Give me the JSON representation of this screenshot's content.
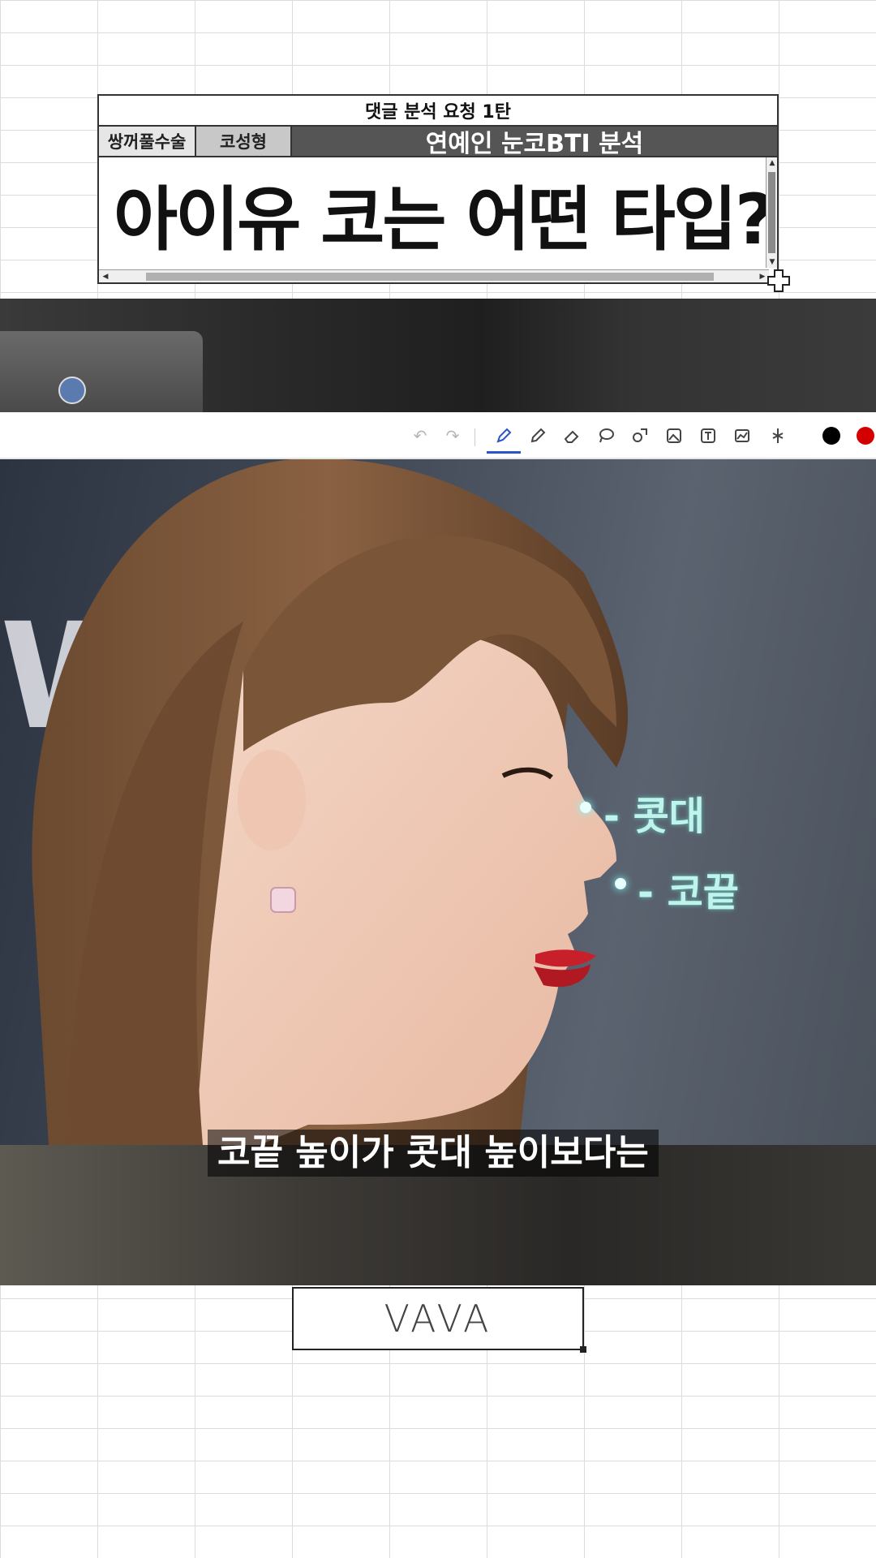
{
  "header": {
    "top_title": "댓글 분석 요청 1탄",
    "tag_1": "쌍꺼풀수술",
    "tag_2": "코성형",
    "tag_3": "연예인 눈코BTI 분석",
    "main_title": "아이유 코는 어떤 타입?"
  },
  "toolbar": {
    "tools": [
      "undo-icon",
      "redo-icon",
      "pen-icon",
      "pencil-icon",
      "eraser-icon",
      "lasso-icon",
      "shapes-icon",
      "image-icon",
      "text-icon",
      "chart-icon",
      "sparkle-icon"
    ],
    "active_tool": "pen-icon",
    "colors": [
      "#000000",
      "#d40000"
    ]
  },
  "photo": {
    "label_1": "- 콧대",
    "label_2": "- 코끝",
    "subtitle": "코끝 높이가 콧대 높이보다는"
  },
  "footer": {
    "logo": "VAVA"
  }
}
